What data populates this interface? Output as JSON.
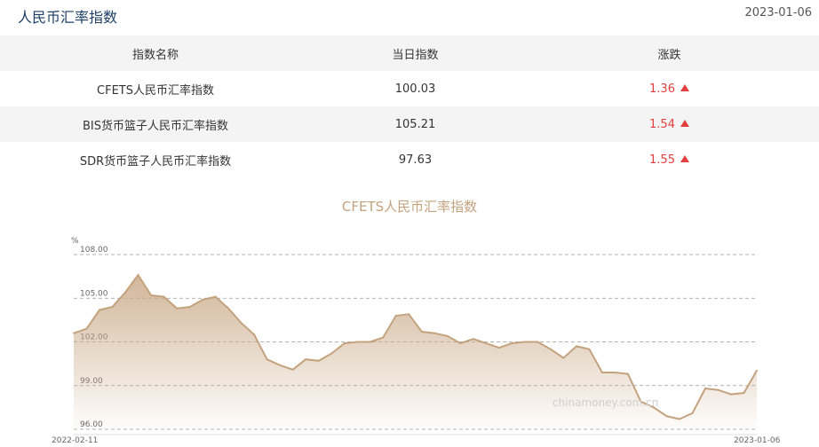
{
  "header": {
    "title": "人民币汇率指数",
    "date": "2023-01-06"
  },
  "table": {
    "columns": [
      "指数名称",
      "当日指数",
      "涨跌"
    ],
    "rows": [
      {
        "name": "CFETS人民币汇率指数",
        "value": "100.03",
        "change": "1.36"
      },
      {
        "name": "BIS货币篮子人民币汇率指数",
        "value": "105.21",
        "change": "1.54"
      },
      {
        "name": "SDR货币篮子人民币汇率指数",
        "value": "97.63",
        "change": "1.55"
      }
    ]
  },
  "watermark": "chinamoney.com.cn",
  "colors": {
    "accent": "#c4a27e",
    "up": "#e33f3f",
    "title": "#1f3f66"
  },
  "chart_data": {
    "type": "area",
    "title": "CFETS人民币汇率指数",
    "ylabel": "%",
    "ylim": [
      96,
      108
    ],
    "yticks": [
      "108.00",
      "105.00",
      "102.00",
      "99.00",
      "96.00"
    ],
    "x_start_label": "2022-02-11",
    "x_end_label": "2023-01-06",
    "grid": true,
    "values": [
      102.6,
      102.9,
      104.2,
      104.4,
      105.4,
      106.6,
      105.2,
      105.1,
      104.3,
      104.4,
      104.9,
      105.1,
      104.3,
      103.3,
      102.5,
      100.8,
      100.4,
      100.1,
      100.8,
      100.7,
      101.2,
      101.9,
      102.0,
      102.0,
      102.3,
      103.8,
      103.9,
      102.7,
      102.6,
      102.4,
      101.9,
      102.2,
      101.9,
      101.6,
      101.9,
      102.0,
      102.0,
      101.5,
      100.9,
      101.7,
      101.5,
      99.9,
      99.9,
      99.8,
      97.9,
      97.5,
      96.9,
      96.7,
      97.1,
      98.8,
      98.7,
      98.4,
      98.5,
      100.03
    ]
  }
}
